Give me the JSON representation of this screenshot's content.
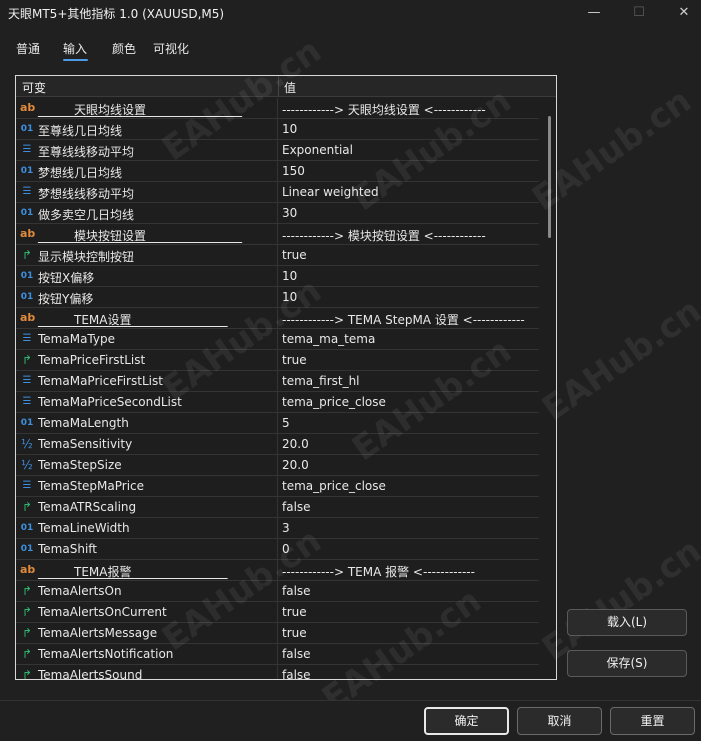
{
  "window": {
    "title": "天眼MT5+其他指标 1.0 (XAUUSD,M5)",
    "minimize_glyph": "—",
    "maximize_glyph": "☐",
    "close_glyph": "✕"
  },
  "tabs": [
    {
      "label": "普通",
      "active": false
    },
    {
      "label": "输入",
      "active": true
    },
    {
      "label": "颜色",
      "active": false
    },
    {
      "label": "可视化",
      "active": false
    }
  ],
  "grid": {
    "col_variable": "可变",
    "col_value": "值",
    "rows": [
      {
        "icon": "ab",
        "name": "______天眼均线设置________________",
        "value": "------------> 天眼均线设置 <------------",
        "section": true
      },
      {
        "icon": "int",
        "name": "至尊线几日均线",
        "value": "10"
      },
      {
        "icon": "enum",
        "name": "至尊线线移动平均",
        "value": "Exponential"
      },
      {
        "icon": "int",
        "name": "梦想线几日均线",
        "value": "150"
      },
      {
        "icon": "enum",
        "name": "梦想线线移动平均",
        "value": "Linear weighted"
      },
      {
        "icon": "int",
        "name": "做多卖空几日均线",
        "value": "30"
      },
      {
        "icon": "ab",
        "name": "______模块按钮设置________________",
        "value": "------------> 模块按钮设置 <------------",
        "section": true
      },
      {
        "icon": "bool",
        "name": "显示模块控制按钮",
        "value": "true"
      },
      {
        "icon": "int",
        "name": "按钮X偏移",
        "value": "10"
      },
      {
        "icon": "int",
        "name": "按钮Y偏移",
        "value": "10"
      },
      {
        "icon": "ab",
        "name": "______TEMA设置________________",
        "value": "------------> TEMA StepMA 设置 <------------",
        "section": true
      },
      {
        "icon": "enum",
        "name": "TemaMaType",
        "value": "tema_ma_tema"
      },
      {
        "icon": "bool",
        "name": "TemaPriceFirstList",
        "value": "true"
      },
      {
        "icon": "enum",
        "name": "TemaMaPriceFirstList",
        "value": "tema_first_hl"
      },
      {
        "icon": "enum",
        "name": "TemaMaPriceSecondList",
        "value": "tema_price_close"
      },
      {
        "icon": "int",
        "name": "TemaMaLength",
        "value": "5"
      },
      {
        "icon": "double",
        "name": "TemaSensitivity",
        "value": "20.0"
      },
      {
        "icon": "double",
        "name": "TemaStepSize",
        "value": "20.0"
      },
      {
        "icon": "enum",
        "name": "TemaStepMaPrice",
        "value": "tema_price_close"
      },
      {
        "icon": "bool",
        "name": "TemaATRScaling",
        "value": "false"
      },
      {
        "icon": "int",
        "name": "TemaLineWidth",
        "value": "3"
      },
      {
        "icon": "int",
        "name": "TemaShift",
        "value": "0"
      },
      {
        "icon": "ab",
        "name": "______TEMA报警________________",
        "value": "------------> TEMA 报警 <------------",
        "section": true
      },
      {
        "icon": "bool",
        "name": "TemaAlertsOn",
        "value": "false"
      },
      {
        "icon": "bool",
        "name": "TemaAlertsOnCurrent",
        "value": "true"
      },
      {
        "icon": "bool",
        "name": "TemaAlertsMessage",
        "value": "true"
      },
      {
        "icon": "bool",
        "name": "TemaAlertsNotification",
        "value": "false"
      },
      {
        "icon": "bool",
        "name": "TemaAlertsSound",
        "value": "false"
      }
    ]
  },
  "side_buttons": {
    "load": "载入(L)",
    "save": "保存(S)"
  },
  "footer": {
    "ok": "确定",
    "cancel": "取消",
    "reset": "重置"
  },
  "watermark": "EAHub.cn",
  "colors": {
    "background": "#202020",
    "accent": "#4c9be8",
    "icon_string": "#e08a3c",
    "icon_int": "#3d8fe0",
    "icon_bool": "#2fb56e"
  }
}
